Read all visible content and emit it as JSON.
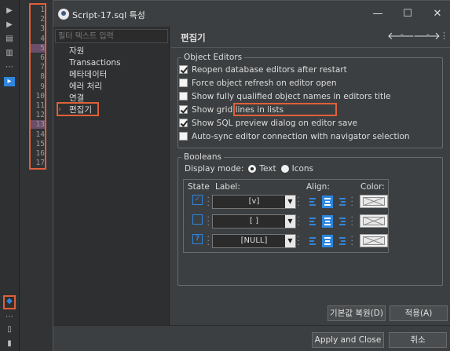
{
  "window": {
    "title": "Script-17.sql 특성",
    "minimize": "—",
    "maximize": "☐",
    "close": "✕"
  },
  "editor": {
    "line_numbers": [
      "1",
      "2",
      "3",
      "4",
      "5",
      "6",
      "7",
      "8",
      "9",
      "10",
      "11",
      "12",
      "13",
      "14",
      "15",
      "16",
      "17"
    ],
    "highlighted_lines": [
      "5",
      "13"
    ]
  },
  "nav": {
    "filter_placeholder": "필터 텍스트 입력",
    "items": [
      {
        "label": "자원"
      },
      {
        "label": "Transactions"
      },
      {
        "label": "메타데이터"
      },
      {
        "label": "에러 처리"
      },
      {
        "label": "연결"
      },
      {
        "label": "편집기"
      }
    ],
    "selected": "편집기"
  },
  "page": {
    "title": "편집기",
    "back": "🡐",
    "forward": "🡒",
    "dropdown": "▾"
  },
  "object_editors": {
    "legend": "Object Editors",
    "options": [
      {
        "label": "Reopen database editors after restart",
        "checked": true
      },
      {
        "label": "Force object refresh on editor open",
        "checked": false
      },
      {
        "label": "Show fully qualified object names in editors title",
        "checked": false
      },
      {
        "label": "Show grid lines in lists",
        "checked": true
      },
      {
        "label": "Show SQL preview dialog on editor save",
        "checked": true
      },
      {
        "label": "Auto-sync editor connection with navigator selection",
        "checked": false
      }
    ]
  },
  "booleans": {
    "legend": "Booleans",
    "display_mode_label": "Display mode:",
    "mode_text": "Text",
    "mode_icons": "Icons",
    "mode_selected": "Text",
    "headers": {
      "state": "State",
      "label": "Label:",
      "align": "Align:",
      "color": "Color:"
    },
    "rows": [
      {
        "state": "checked",
        "state_glyph": "✓",
        "label": "[v]",
        "align": "center"
      },
      {
        "state": "unchecked",
        "state_glyph": "",
        "label": "[ ]",
        "align": "center"
      },
      {
        "state": "null",
        "state_glyph": "?",
        "label": "[NULL]",
        "align": "center"
      }
    ]
  },
  "buttons": {
    "restore_defaults": "기본값 복원(D)",
    "apply": "적용(A)",
    "apply_and_close": "Apply and Close",
    "cancel": "취소"
  },
  "colors": {
    "accent": "#2e86de",
    "highlight": "#e0603a"
  }
}
